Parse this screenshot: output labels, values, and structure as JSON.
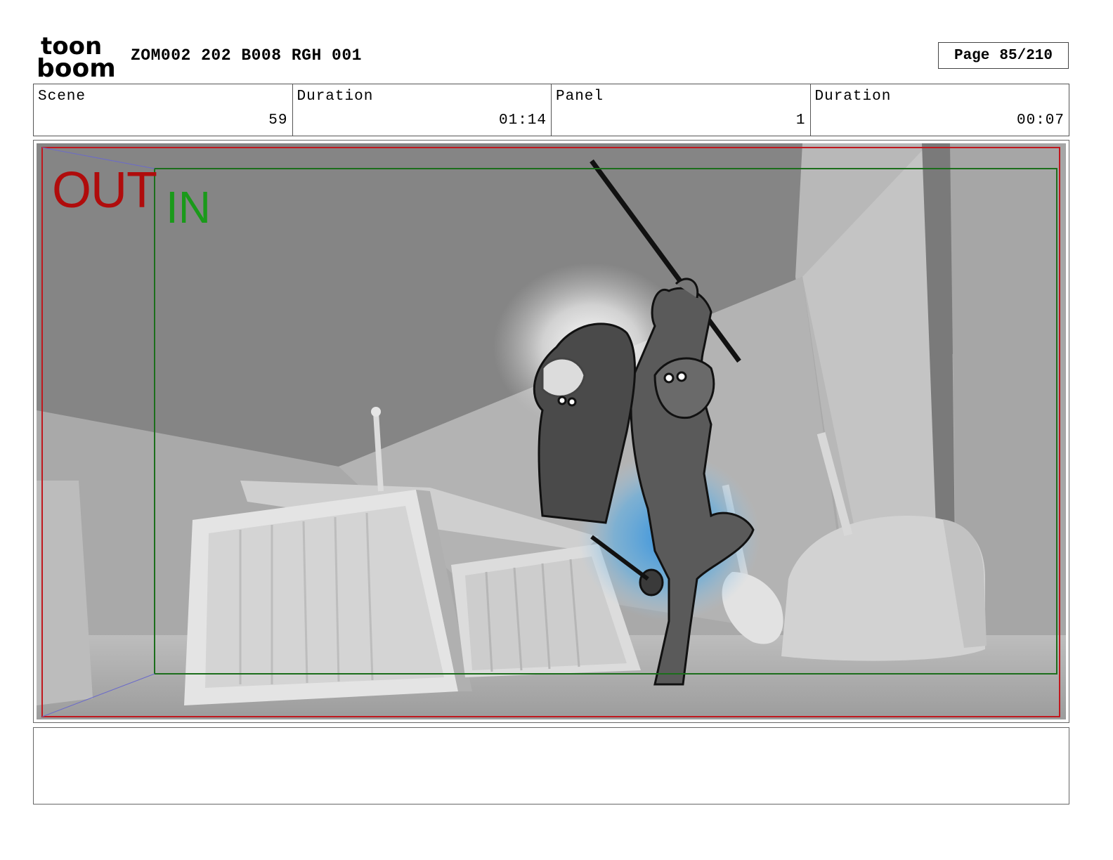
{
  "header": {
    "logo_line1": "toon",
    "logo_line2": "boom",
    "doc_title": "ZOM002 202 B008 RGH 001",
    "page_label": "Page",
    "page_value": "85/210"
  },
  "info": {
    "scene_label": "Scene",
    "scene_value": "59",
    "scene_duration_label": "Duration",
    "scene_duration_value": "01:14",
    "panel_label": "Panel",
    "panel_value": "1",
    "panel_duration_label": "Duration",
    "panel_duration_value": "00:07"
  },
  "panel": {
    "out_label": "OUT",
    "in_label": "IN",
    "colors": {
      "out_frame": "#c0181e",
      "in_frame": "#1c6e1c",
      "glow": "#3ea0e6"
    }
  },
  "notes": {
    "text": ""
  }
}
